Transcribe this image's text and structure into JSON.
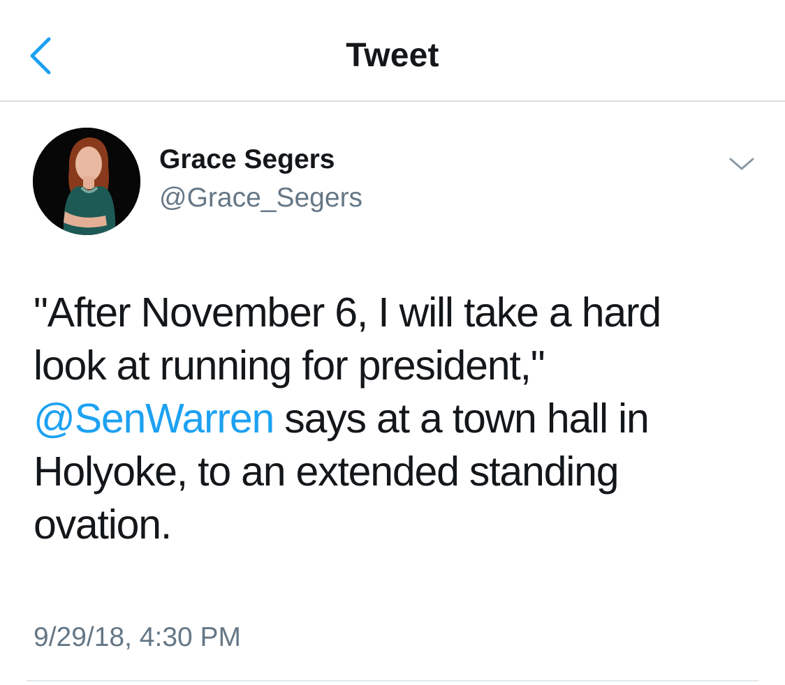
{
  "nav": {
    "back_icon": "chevron-left-icon",
    "title": "Tweet"
  },
  "tweet": {
    "author": {
      "display_name": "Grace Segers",
      "handle": "@Grace_Segers"
    },
    "menu_icon": "chevron-down-icon",
    "text": {
      "line1": "\"After November 6, I will take a hard",
      "line2": "look at running for president,\"",
      "mention": "@SenWarren",
      "line3_rest": " says at a town hall in",
      "line4": "Holyoke, to an extended standing",
      "line5": "ovation."
    },
    "timestamp": "9/29/18, 4:30 PM"
  },
  "colors": {
    "accent": "#1da1f2",
    "primary_text": "#14171a",
    "secondary_text": "#657786",
    "divider": "#e1e8ed"
  }
}
